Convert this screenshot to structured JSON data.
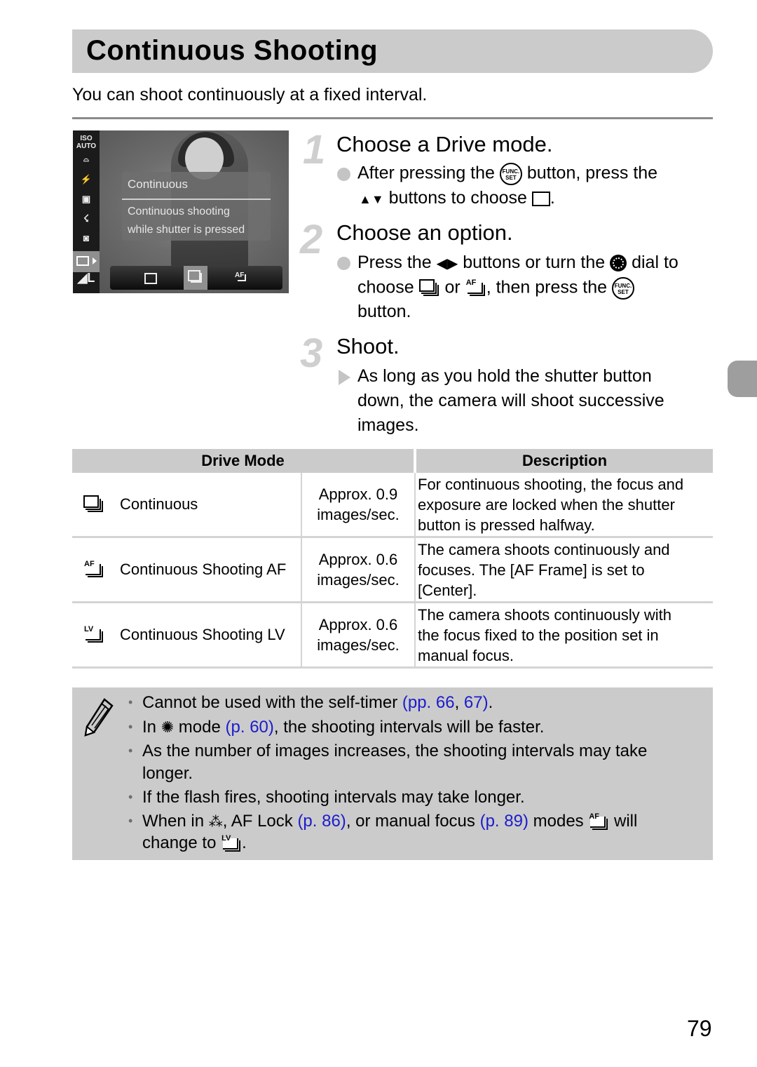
{
  "page": {
    "title": "Continuous Shooting",
    "intro": "You can shoot continuously at a fixed interval.",
    "page_number": "79"
  },
  "camera_screen": {
    "side_menu_icons": [
      "iso-auto-icon",
      "white-balance-icon",
      "red-eye-off-icon",
      "zoom-off-icon",
      "flash-exposure-icon",
      "metering-icon",
      "drive-mode-icon",
      "image-quality-icon"
    ],
    "iso_label": "ISO",
    "iso_sub": "AUTO",
    "selected_menu": "drive-mode",
    "overlay_title": "Continuous",
    "overlay_desc_line1": "Continuous shooting",
    "overlay_desc_line2": "while shutter is pressed",
    "options": [
      "single-shot",
      "continuous",
      "continuous-af"
    ],
    "selected_option": "continuous"
  },
  "steps": [
    {
      "number": "1",
      "title": "Choose a Drive mode.",
      "line1_a": "After pressing the",
      "line1_b": "button, press the",
      "line2": "buttons to choose",
      "line2_end": "."
    },
    {
      "number": "2",
      "title": "Choose an option.",
      "line1_a": "Press the",
      "line1_b": "buttons or turn the",
      "line1_c": "dial to",
      "line2_a": "choose",
      "line2_b": "or",
      "line2_c": ", then press the",
      "line3": "button."
    },
    {
      "number": "3",
      "title": "Shoot.",
      "lines": [
        "As long as you hold the shutter button",
        "down, the camera will shoot successive",
        "images."
      ]
    }
  ],
  "func_label_top": "FUNC.",
  "func_label_bottom": "SET",
  "table": {
    "headers": [
      "Drive Mode",
      "Description"
    ],
    "rows": [
      {
        "icon": "continuous-icon",
        "icon_label": "",
        "mode": "Continuous",
        "rate1": "Approx. 0.9",
        "rate2": "images/sec.",
        "desc": [
          "For continuous shooting, the focus and",
          "exposure are locked when the shutter",
          "button is pressed halfway."
        ]
      },
      {
        "icon": "continuous-af-icon",
        "icon_label": "AF",
        "mode": "Continuous Shooting AF",
        "rate1": "Approx. 0.6",
        "rate2": "images/sec.",
        "desc": [
          "The camera shoots continuously and",
          "focuses. The [AF Frame] is set to",
          "[Center]."
        ]
      },
      {
        "icon": "continuous-lv-icon",
        "icon_label": "LV",
        "mode": "Continuous Shooting LV",
        "rate1": "Approx. 0.6",
        "rate2": "images/sec.",
        "desc": [
          "The camera shoots continuously with",
          "the focus fixed to the position set in",
          "manual focus."
        ]
      }
    ]
  },
  "notes": {
    "n1_text": "Cannot be used with the self-timer ",
    "n1_link1": "(pp. 66",
    "n1_sep": ", ",
    "n1_link2": "67)",
    "n1_end": ".",
    "n2_a": "In",
    "n2_b": "mode",
    "n2_link": "(p. 60)",
    "n2_end": ", the shooting intervals will be faster.",
    "n3_line1": "As the number of images increases, the shooting intervals may take",
    "n3_line2": "longer.",
    "n4": "If the flash fires, shooting intervals may take longer.",
    "n5_a": "When in",
    "n5_b": ", AF Lock",
    "n5_link1": "(p. 86)",
    "n5_c": ", or manual focus",
    "n5_link2": "(p. 89)",
    "n5_d": "modes",
    "n5_e": "will",
    "n5_line2_a": "change to",
    "n5_line2_end": "."
  },
  "colors": {
    "title_bar": "#cbcbcb",
    "link": "#1c1ccc",
    "step_number": "#cfcfcf",
    "side_tab": "#9e9e9e"
  }
}
